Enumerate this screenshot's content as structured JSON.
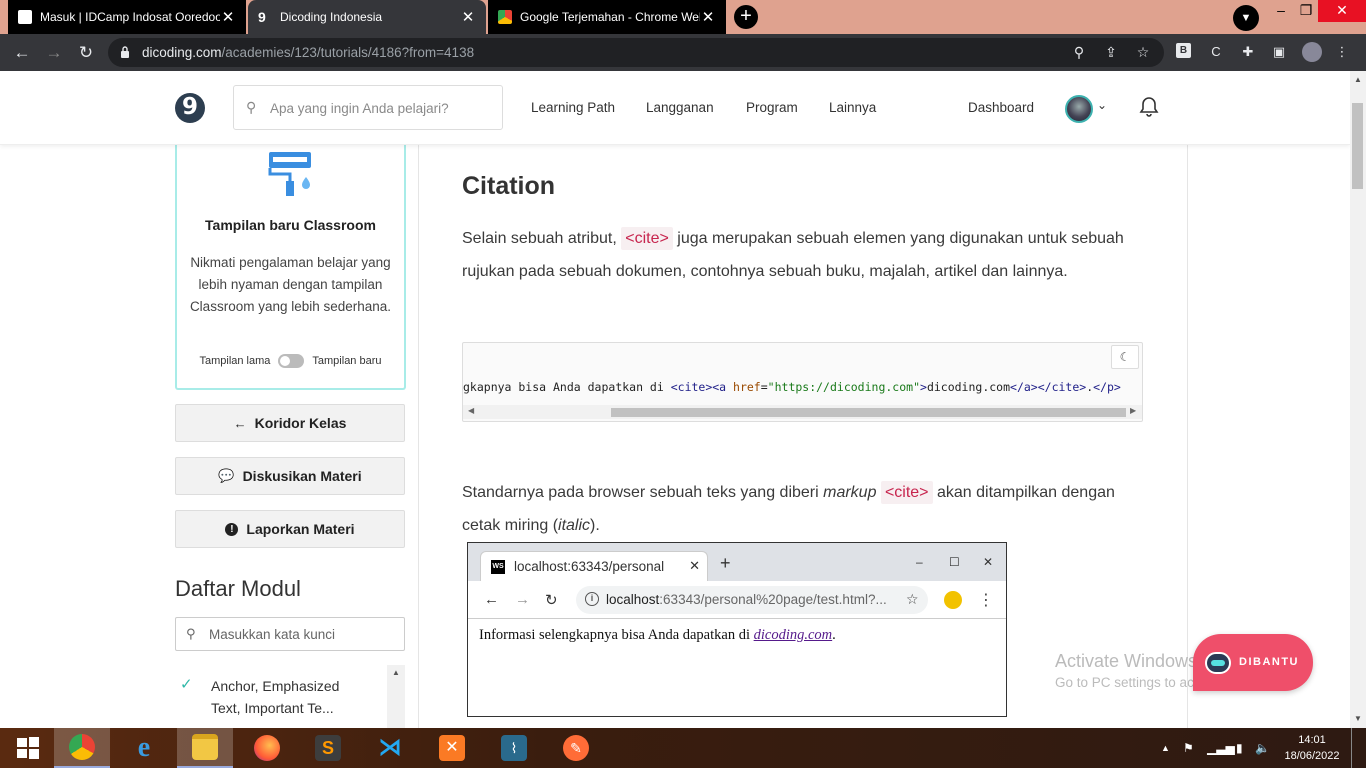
{
  "browser": {
    "tabs": [
      {
        "title": "Masuk | IDCamp Indosat Ooredoo",
        "active": false
      },
      {
        "title": "Dicoding Indonesia",
        "active": true
      },
      {
        "title": "Google Terjemahan - Chrome Web Store",
        "active": false
      }
    ],
    "url_host": "dicoding.com",
    "url_path": "/academies/123/tutorials/4186?from=4138",
    "ext_b": "B",
    "ext_c": "C"
  },
  "header": {
    "logo": "9",
    "search_placeholder": "Apa yang ingin Anda pelajari?",
    "nav": [
      "Learning Path",
      "Langganan",
      "Program",
      "Lainnya"
    ],
    "dashboard": "Dashboard"
  },
  "sidebar": {
    "classroom_title": "Tampilan baru Classroom",
    "classroom_desc": "Nikmati pengalaman belajar yang lebih nyaman dengan tampilan Classroom yang lebih sederhana.",
    "toggle_old": "Tampilan lama",
    "toggle_new": "Tampilan baru",
    "buttons": [
      "Koridor Kelas",
      "Diskusikan Materi",
      "Laporkan Materi"
    ],
    "module_title": "Daftar Modul",
    "module_search_placeholder": "Masukkan kata kunci",
    "modules": [
      {
        "label": "Anchor, Emphasized Text, Important Te...",
        "done": true
      }
    ]
  },
  "article": {
    "heading": "Citation",
    "p1_before": "Selain sebuah atribut, ",
    "p1_code": "<cite>",
    "p1_after": " juga merupakan sebuah elemen yang digunakan untuk sebuah rujukan pada sebuah dokumen, contohnya sebuah buku, majalah, artikel dan lainnya.",
    "code": {
      "text": "gkapnya bisa Anda dapatkan di ",
      "t1": "<cite><a ",
      "attr": "href",
      "eq": "=",
      "str": "\"https://dicoding.com\"",
      "t2": ">",
      "link": "dicoding.com",
      "t3": "</a></cite>",
      "t4": ".",
      "t5": "</p>"
    },
    "p2_before": "Standarnya pada browser sebuah teks yang diberi ",
    "p2_em": "markup",
    "p2_code": "<cite>",
    "p2_after": " akan ditampilkan dengan cetak miring (",
    "p2_em2": "italic",
    "p2_end": ")."
  },
  "screenshot": {
    "tab_title": "localhost:63343/personal",
    "url_host": "localhost",
    "url_rest": ":63343/personal%20page/test.html?...",
    "body_text": "Informasi selengkapnya bisa Anda dapatkan di ",
    "link": "dicoding.com",
    "period": "."
  },
  "overlay": {
    "activate_title": "Activate Windows",
    "activate_sub": "Go to PC settings to activate Windows.",
    "dibantu": "DIBANTU"
  },
  "taskbar": {
    "time": "14:01",
    "date": "18/06/2022"
  },
  "colors": {
    "accent": "#2fb8a8",
    "code_pink": "#c7254e",
    "dibantu": "#ef4f6a"
  }
}
